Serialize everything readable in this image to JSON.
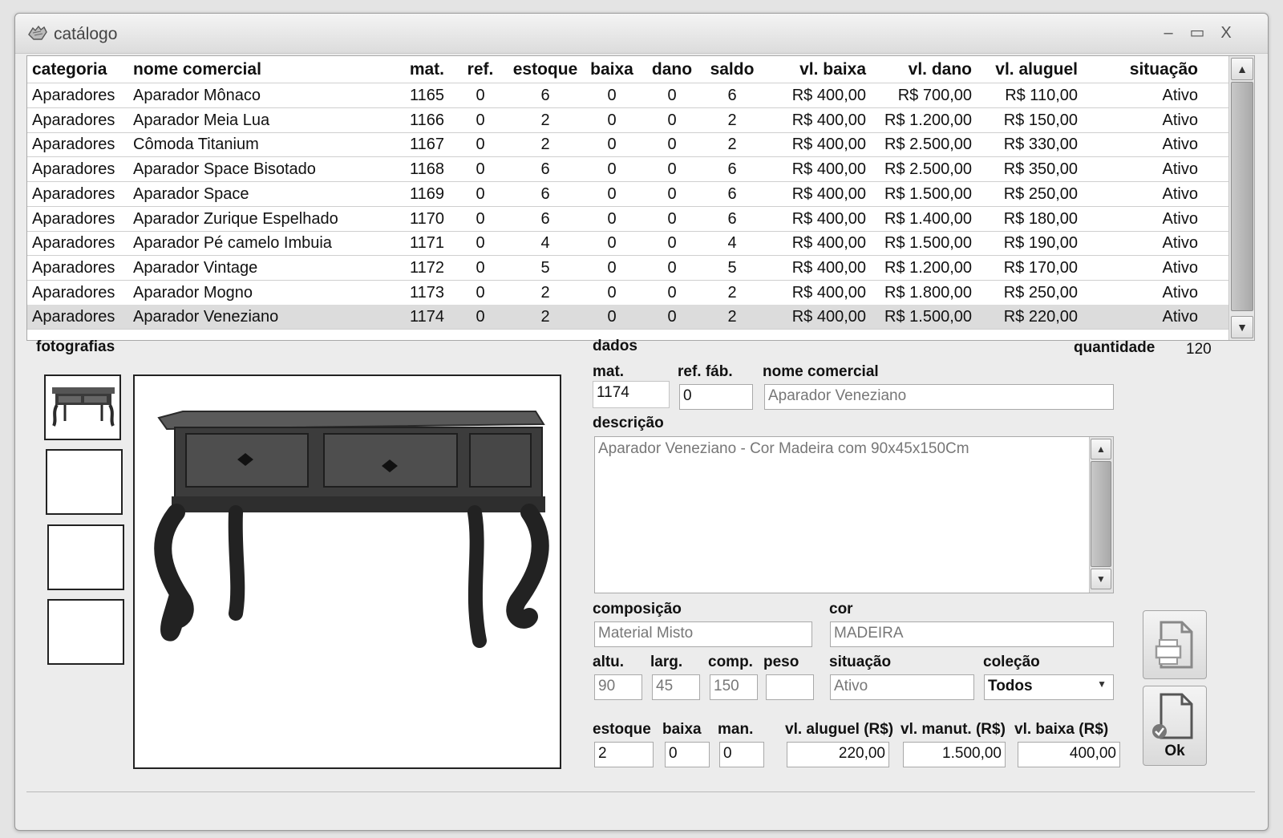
{
  "window": {
    "title": "catálogo",
    "icon": "hand-icon",
    "controls": {
      "minimize": "–",
      "maximize": "▭",
      "close": "X"
    }
  },
  "grid": {
    "headers": [
      "categoria",
      "nome comercial",
      "mat.",
      "ref.",
      "estoque",
      "baixa",
      "dano",
      "saldo",
      "vl. baixa",
      "vl. dano",
      "vl. aluguel",
      "situação"
    ],
    "rows": [
      [
        "Aparadores",
        "Aparador Mônaco",
        "1165",
        "0",
        "6",
        "0",
        "0",
        "6",
        "R$ 400,00",
        "R$ 700,00",
        "R$ 110,00",
        "Ativo"
      ],
      [
        "Aparadores",
        "Aparador Meia Lua",
        "1166",
        "0",
        "2",
        "0",
        "0",
        "2",
        "R$ 400,00",
        "R$ 1.200,00",
        "R$ 150,00",
        "Ativo"
      ],
      [
        "Aparadores",
        "Cômoda Titanium",
        "1167",
        "0",
        "2",
        "0",
        "0",
        "2",
        "R$ 400,00",
        "R$ 2.500,00",
        "R$ 330,00",
        "Ativo"
      ],
      [
        "Aparadores",
        "Aparador Space Bisotado",
        "1168",
        "0",
        "6",
        "0",
        "0",
        "6",
        "R$ 400,00",
        "R$ 2.500,00",
        "R$ 350,00",
        "Ativo"
      ],
      [
        "Aparadores",
        "Aparador Space",
        "1169",
        "0",
        "6",
        "0",
        "0",
        "6",
        "R$ 400,00",
        "R$ 1.500,00",
        "R$ 250,00",
        "Ativo"
      ],
      [
        "Aparadores",
        "Aparador Zurique Espelhado",
        "1170",
        "0",
        "6",
        "0",
        "0",
        "6",
        "R$ 400,00",
        "R$ 1.400,00",
        "R$ 180,00",
        "Ativo"
      ],
      [
        "Aparadores",
        "Aparador Pé camelo Imbuia",
        "1171",
        "0",
        "4",
        "0",
        "0",
        "4",
        "R$ 400,00",
        "R$ 1.500,00",
        "R$ 190,00",
        "Ativo"
      ],
      [
        "Aparadores",
        "Aparador Vintage",
        "1172",
        "0",
        "5",
        "0",
        "0",
        "5",
        "R$ 400,00",
        "R$ 1.200,00",
        "R$ 170,00",
        "Ativo"
      ],
      [
        "Aparadores",
        "Aparador Mogno",
        "1173",
        "0",
        "2",
        "0",
        "0",
        "2",
        "R$ 400,00",
        "R$ 1.800,00",
        "R$ 250,00",
        "Ativo"
      ],
      [
        "Aparadores",
        "Aparador Veneziano",
        "1174",
        "0",
        "2",
        "0",
        "0",
        "2",
        "R$ 400,00",
        "R$ 1.500,00",
        "R$ 220,00",
        "Ativo"
      ]
    ],
    "selected_row_index": 9
  },
  "photos": {
    "label": "fotografias"
  },
  "dados": {
    "section_label": "dados",
    "quantidade_label": "quantidade",
    "quantidade_value": "120",
    "mat_label": "mat.",
    "mat_value": "1174",
    "ref_label": "ref. fáb.",
    "ref_value": "0",
    "nome_label": "nome comercial",
    "nome_value": "Aparador Veneziano",
    "descricao_label": "descrição",
    "descricao_value": "Aparador Veneziano - Cor Madeira com 90x45x150Cm",
    "composicao_label": "composição",
    "composicao_value": "Material Misto",
    "cor_label": "cor",
    "cor_value": "MADEIRA",
    "altu_label": "altu.",
    "altu_value": "90",
    "larg_label": "larg.",
    "larg_value": "45",
    "comp_label": "comp.",
    "comp_value": "150",
    "peso_label": "peso",
    "peso_value": "",
    "situacao_label": "situação",
    "situacao_value": "Ativo",
    "colecao_label": "coleção",
    "colecao_value": "Todos",
    "estoque_label": "estoque",
    "estoque_value": "2",
    "baixa_label": "baixa",
    "baixa_value": "0",
    "man_label": "man.",
    "man_value": "0",
    "vl_aluguel_label": "vl. aluguel (R$)",
    "vl_aluguel_value": "220,00",
    "vl_manut_label": "vl. manut. (R$)",
    "vl_manut_value": "1.500,00",
    "vl_baixa_label": "vl. baixa (R$)",
    "vl_baixa_value": "400,00"
  },
  "actions": {
    "print_icon": "printer-document-icon",
    "ok_label": "Ok",
    "ok_icon": "document-check-icon"
  }
}
